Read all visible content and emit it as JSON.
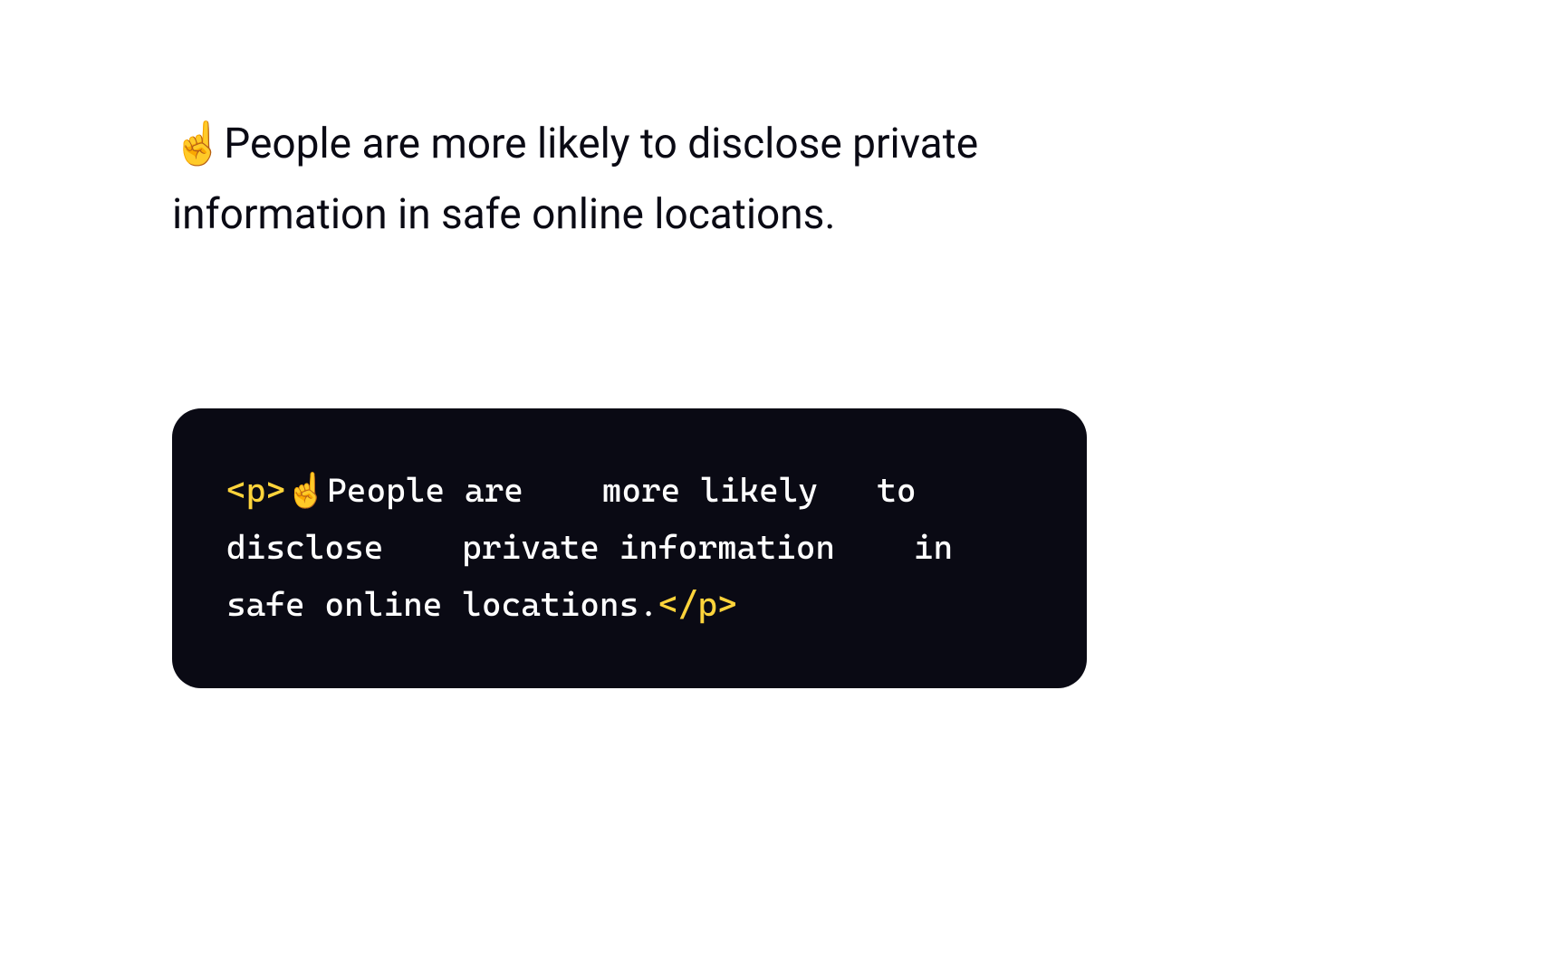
{
  "paragraph": {
    "emoji": "☝️",
    "text": "People are more likely to disclose private information in safe online locations."
  },
  "code": {
    "open_tag": "<p>",
    "emoji": "☝️",
    "content": "People are    more likely   to disclose    private information    in safe online locations.",
    "close_tag": "</p>"
  }
}
